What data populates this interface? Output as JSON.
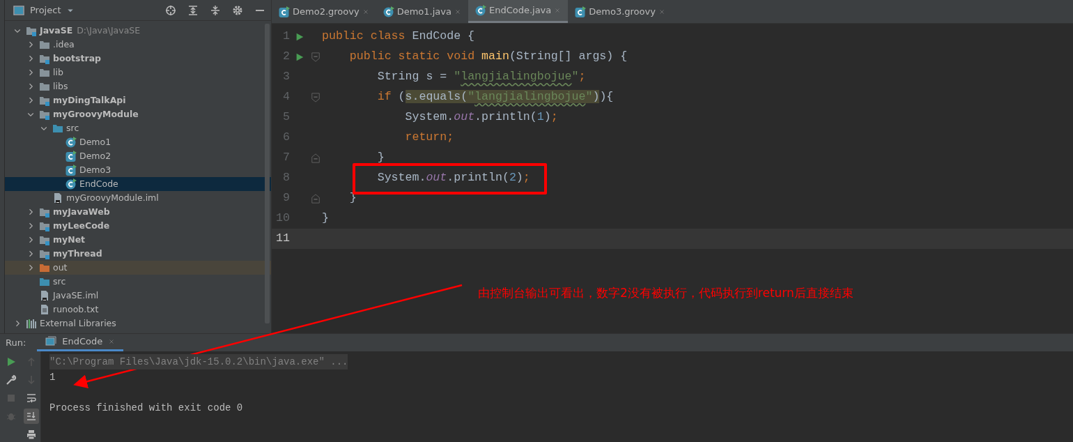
{
  "project_panel": {
    "title": "Project",
    "tree": [
      {
        "label": "JavaSE",
        "detail": "D:\\Java\\JavaSE",
        "kind": "module",
        "expanded": true,
        "selected": false,
        "children": [
          {
            "label": ".idea",
            "kind": "folder",
            "expanded": false,
            "selected": false
          },
          {
            "label": "bootstrap",
            "kind": "module",
            "expanded": false,
            "selected": false
          },
          {
            "label": "lib",
            "kind": "folder",
            "expanded": false,
            "selected": false
          },
          {
            "label": "libs",
            "kind": "folder",
            "expanded": false,
            "selected": false
          },
          {
            "label": "myDingTalkApi",
            "kind": "module",
            "expanded": false,
            "selected": false
          },
          {
            "label": "myGroovyModule",
            "kind": "module",
            "expanded": true,
            "selected": false,
            "children": [
              {
                "label": "src",
                "kind": "source-folder",
                "expanded": true,
                "selected": false,
                "children": [
                  {
                    "label": "Demo1",
                    "kind": "class",
                    "selected": false
                  },
                  {
                    "label": "Demo2",
                    "kind": "groovy-class",
                    "selected": false
                  },
                  {
                    "label": "Demo3",
                    "kind": "groovy-class",
                    "selected": false
                  },
                  {
                    "label": "EndCode",
                    "kind": "class",
                    "selected": true
                  }
                ]
              },
              {
                "label": "myGroovyModule.iml",
                "kind": "iml",
                "selected": false
              }
            ]
          },
          {
            "label": "myJavaWeb",
            "kind": "module",
            "expanded": false,
            "selected": false
          },
          {
            "label": "myLeeCode",
            "kind": "module",
            "expanded": false,
            "selected": false
          },
          {
            "label": "myNet",
            "kind": "module",
            "expanded": false,
            "selected": false
          },
          {
            "label": "myThread",
            "kind": "module",
            "expanded": false,
            "selected": false
          },
          {
            "label": "out",
            "kind": "excluded-folder",
            "expanded": false,
            "selected": false
          },
          {
            "label": "src",
            "kind": "source-folder",
            "selected": false
          },
          {
            "label": "JavaSE.iml",
            "kind": "iml",
            "selected": false
          },
          {
            "label": "runoob.txt",
            "kind": "text-file",
            "selected": false
          }
        ]
      },
      {
        "label": "External Libraries",
        "kind": "libraries",
        "expanded": false,
        "selected": false
      }
    ]
  },
  "editor": {
    "tabs": [
      {
        "label": "Demo2.groovy",
        "kind": "groovy",
        "selected": false
      },
      {
        "label": "Demo1.java",
        "kind": "java",
        "selected": false
      },
      {
        "label": "EndCode.java",
        "kind": "java",
        "selected": true
      },
      {
        "label": "Demo3.groovy",
        "kind": "groovy",
        "selected": false
      }
    ],
    "lines": [
      {
        "number": "1",
        "run_marker": true,
        "fold_start": false,
        "fold_end": false,
        "current": false,
        "boxed": false,
        "tokens": [
          {
            "kind": "keyword",
            "text": "public class "
          },
          {
            "kind": "plain",
            "text": "EndCode {"
          }
        ]
      },
      {
        "number": "2",
        "run_marker": true,
        "fold_start": true,
        "fold_end": false,
        "current": false,
        "boxed": false,
        "tokens": [
          {
            "kind": "keyword",
            "text": "    public static void "
          },
          {
            "kind": "method",
            "text": "main"
          },
          {
            "kind": "plain",
            "text": "(String[] args) {"
          }
        ]
      },
      {
        "number": "3",
        "run_marker": false,
        "fold_start": false,
        "fold_end": false,
        "current": false,
        "boxed": false,
        "tokens": [
          {
            "kind": "plain",
            "text": "        String s = "
          },
          {
            "kind": "string",
            "text": "\""
          },
          {
            "kind": "string-warn",
            "text": "langjialingbojue"
          },
          {
            "kind": "string",
            "text": "\""
          },
          {
            "kind": "keyword",
            "text": ";"
          }
        ]
      },
      {
        "number": "4",
        "run_marker": false,
        "fold_start": true,
        "fold_end": false,
        "current": false,
        "boxed": false,
        "tokens": [
          {
            "kind": "keyword",
            "text": "        if "
          },
          {
            "kind": "plain",
            "text": "("
          },
          {
            "kind": "hl-plain",
            "text": "s.equals("
          },
          {
            "kind": "hl-string",
            "text": "\""
          },
          {
            "kind": "hl-string-warn",
            "text": "langjialingbojue"
          },
          {
            "kind": "hl-string",
            "text": "\""
          },
          {
            "kind": "hl-plain",
            "text": ")"
          },
          {
            "kind": "plain",
            "text": "){"
          }
        ]
      },
      {
        "number": "5",
        "run_marker": false,
        "fold_start": false,
        "fold_end": false,
        "current": false,
        "boxed": false,
        "tokens": [
          {
            "kind": "plain",
            "text": "            System."
          },
          {
            "kind": "field",
            "text": "out"
          },
          {
            "kind": "plain",
            "text": ".println("
          },
          {
            "kind": "number",
            "text": "1"
          },
          {
            "kind": "plain",
            "text": ")"
          },
          {
            "kind": "keyword",
            "text": ";"
          }
        ]
      },
      {
        "number": "6",
        "run_marker": false,
        "fold_start": false,
        "fold_end": false,
        "current": false,
        "boxed": false,
        "tokens": [
          {
            "kind": "keyword",
            "text": "            return;"
          }
        ]
      },
      {
        "number": "7",
        "run_marker": false,
        "fold_start": false,
        "fold_end": true,
        "current": false,
        "boxed": false,
        "tokens": [
          {
            "kind": "plain",
            "text": "        }"
          }
        ]
      },
      {
        "number": "8",
        "run_marker": false,
        "fold_start": false,
        "fold_end": false,
        "current": false,
        "boxed": true,
        "tokens": [
          {
            "kind": "plain",
            "text": "        System."
          },
          {
            "kind": "field",
            "text": "out"
          },
          {
            "kind": "plain",
            "text": ".println("
          },
          {
            "kind": "number",
            "text": "2"
          },
          {
            "kind": "plain",
            "text": ")"
          },
          {
            "kind": "keyword",
            "text": ";"
          }
        ]
      },
      {
        "number": "9",
        "run_marker": false,
        "fold_start": false,
        "fold_end": true,
        "current": false,
        "boxed": false,
        "tokens": [
          {
            "kind": "plain",
            "text": "    }"
          }
        ]
      },
      {
        "number": "10",
        "run_marker": false,
        "fold_start": false,
        "fold_end": false,
        "current": false,
        "boxed": false,
        "tokens": [
          {
            "kind": "plain",
            "text": "}"
          }
        ]
      },
      {
        "number": "11",
        "run_marker": false,
        "fold_start": false,
        "fold_end": false,
        "current": true,
        "boxed": false
      }
    ]
  },
  "run_panel": {
    "label": "Run:",
    "tab": {
      "label": "EndCode",
      "selected": true
    },
    "console": [
      {
        "kind": "command",
        "text": "\"C:\\Program Files\\Java\\jdk-15.0.2\\bin\\java.exe\" ..."
      },
      {
        "kind": "output",
        "text": "1"
      },
      {
        "kind": "info",
        "text": "Process finished with exit code 0"
      }
    ]
  },
  "annotation": {
    "text": "由控制台输出可看出，数字2没有被执行，代码执行到return后直接结束"
  }
}
